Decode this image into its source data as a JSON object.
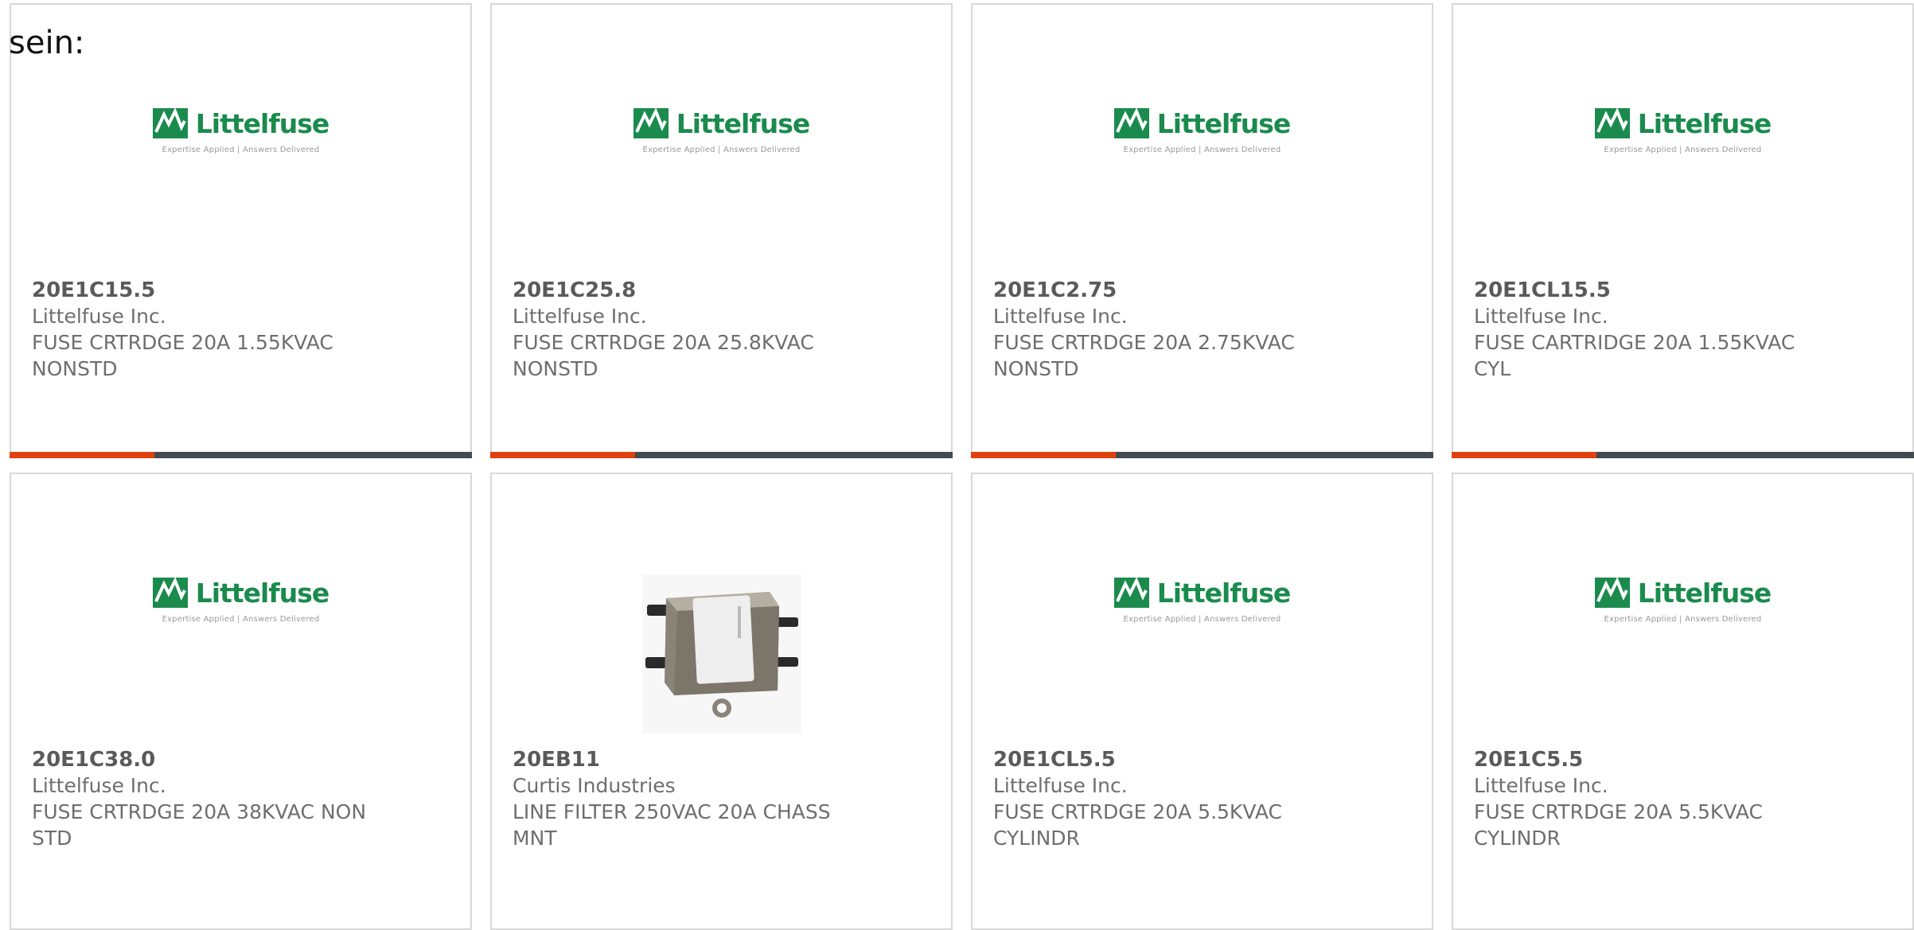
{
  "heading": "sein:",
  "colors": {
    "brand_green": "#1a8b4d",
    "accent_orange": "#e0420f",
    "bar_dark": "#444a4f"
  },
  "logo": {
    "word": "Littelfuse",
    "tagline": "Expertise Applied | Answers Delivered"
  },
  "products": [
    {
      "part": "20E1C15.5",
      "manufacturer": "Littelfuse Inc.",
      "description": "FUSE CRTRDGE 20A 1.55KVAC NONSTD",
      "image": "littelfuse-logo"
    },
    {
      "part": "20E1C25.8",
      "manufacturer": "Littelfuse Inc.",
      "description": "FUSE CRTRDGE 20A 25.8KVAC NONSTD",
      "image": "littelfuse-logo"
    },
    {
      "part": "20E1C2.75",
      "manufacturer": "Littelfuse Inc.",
      "description": "FUSE CRTRDGE 20A 2.75KVAC NONSTD",
      "image": "littelfuse-logo"
    },
    {
      "part": "20E1CL15.5",
      "manufacturer": "Littelfuse Inc.",
      "description": "FUSE CARTRIDGE 20A 1.55KVAC CYL",
      "image": "littelfuse-logo"
    },
    {
      "part": "20E1C38.0",
      "manufacturer": "Littelfuse Inc.",
      "description": "FUSE CRTRDGE 20A 38KVAC NON STD",
      "image": "littelfuse-logo"
    },
    {
      "part": "20EB11",
      "manufacturer": "Curtis Industries",
      "description": "LINE FILTER 250VAC 20A CHASS MNT",
      "image": "line-filter-photo"
    },
    {
      "part": "20E1CL5.5",
      "manufacturer": "Littelfuse Inc.",
      "description": "FUSE CRTRDGE 20A 5.5KVAC CYLINDR",
      "image": "littelfuse-logo"
    },
    {
      "part": "20E1C5.5",
      "manufacturer": "Littelfuse Inc.",
      "description": "FUSE CRTRDGE 20A 5.5KVAC CYLINDR",
      "image": "littelfuse-logo"
    }
  ]
}
